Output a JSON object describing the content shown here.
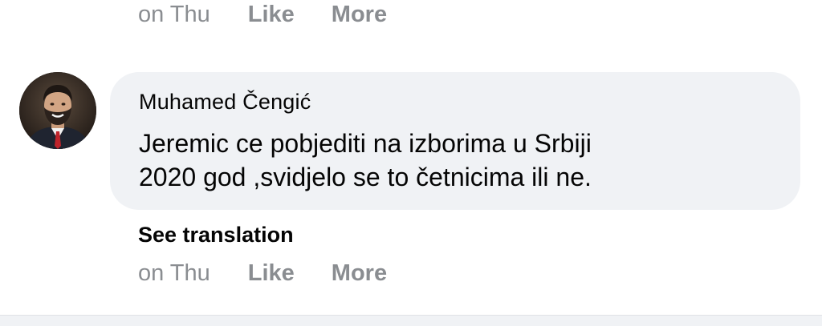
{
  "prev_comment": {
    "time": "on Thu",
    "like_label": "Like",
    "more_label": "More"
  },
  "comment": {
    "author": "Muhamed Čengić",
    "text_line1": "Jeremic ce pobjediti na izborima u Srbiji",
    "text_line2": "2020 god ,svidjelo se to četnicima ili ne.",
    "see_translation_label": "See translation",
    "time": "on Thu",
    "like_label": "Like",
    "more_label": "More"
  },
  "colors": {
    "bubble_bg": "#f0f2f5",
    "text_primary": "#050505",
    "text_secondary": "#8a8d91"
  },
  "icons": {
    "avatar": "profile-photo"
  }
}
